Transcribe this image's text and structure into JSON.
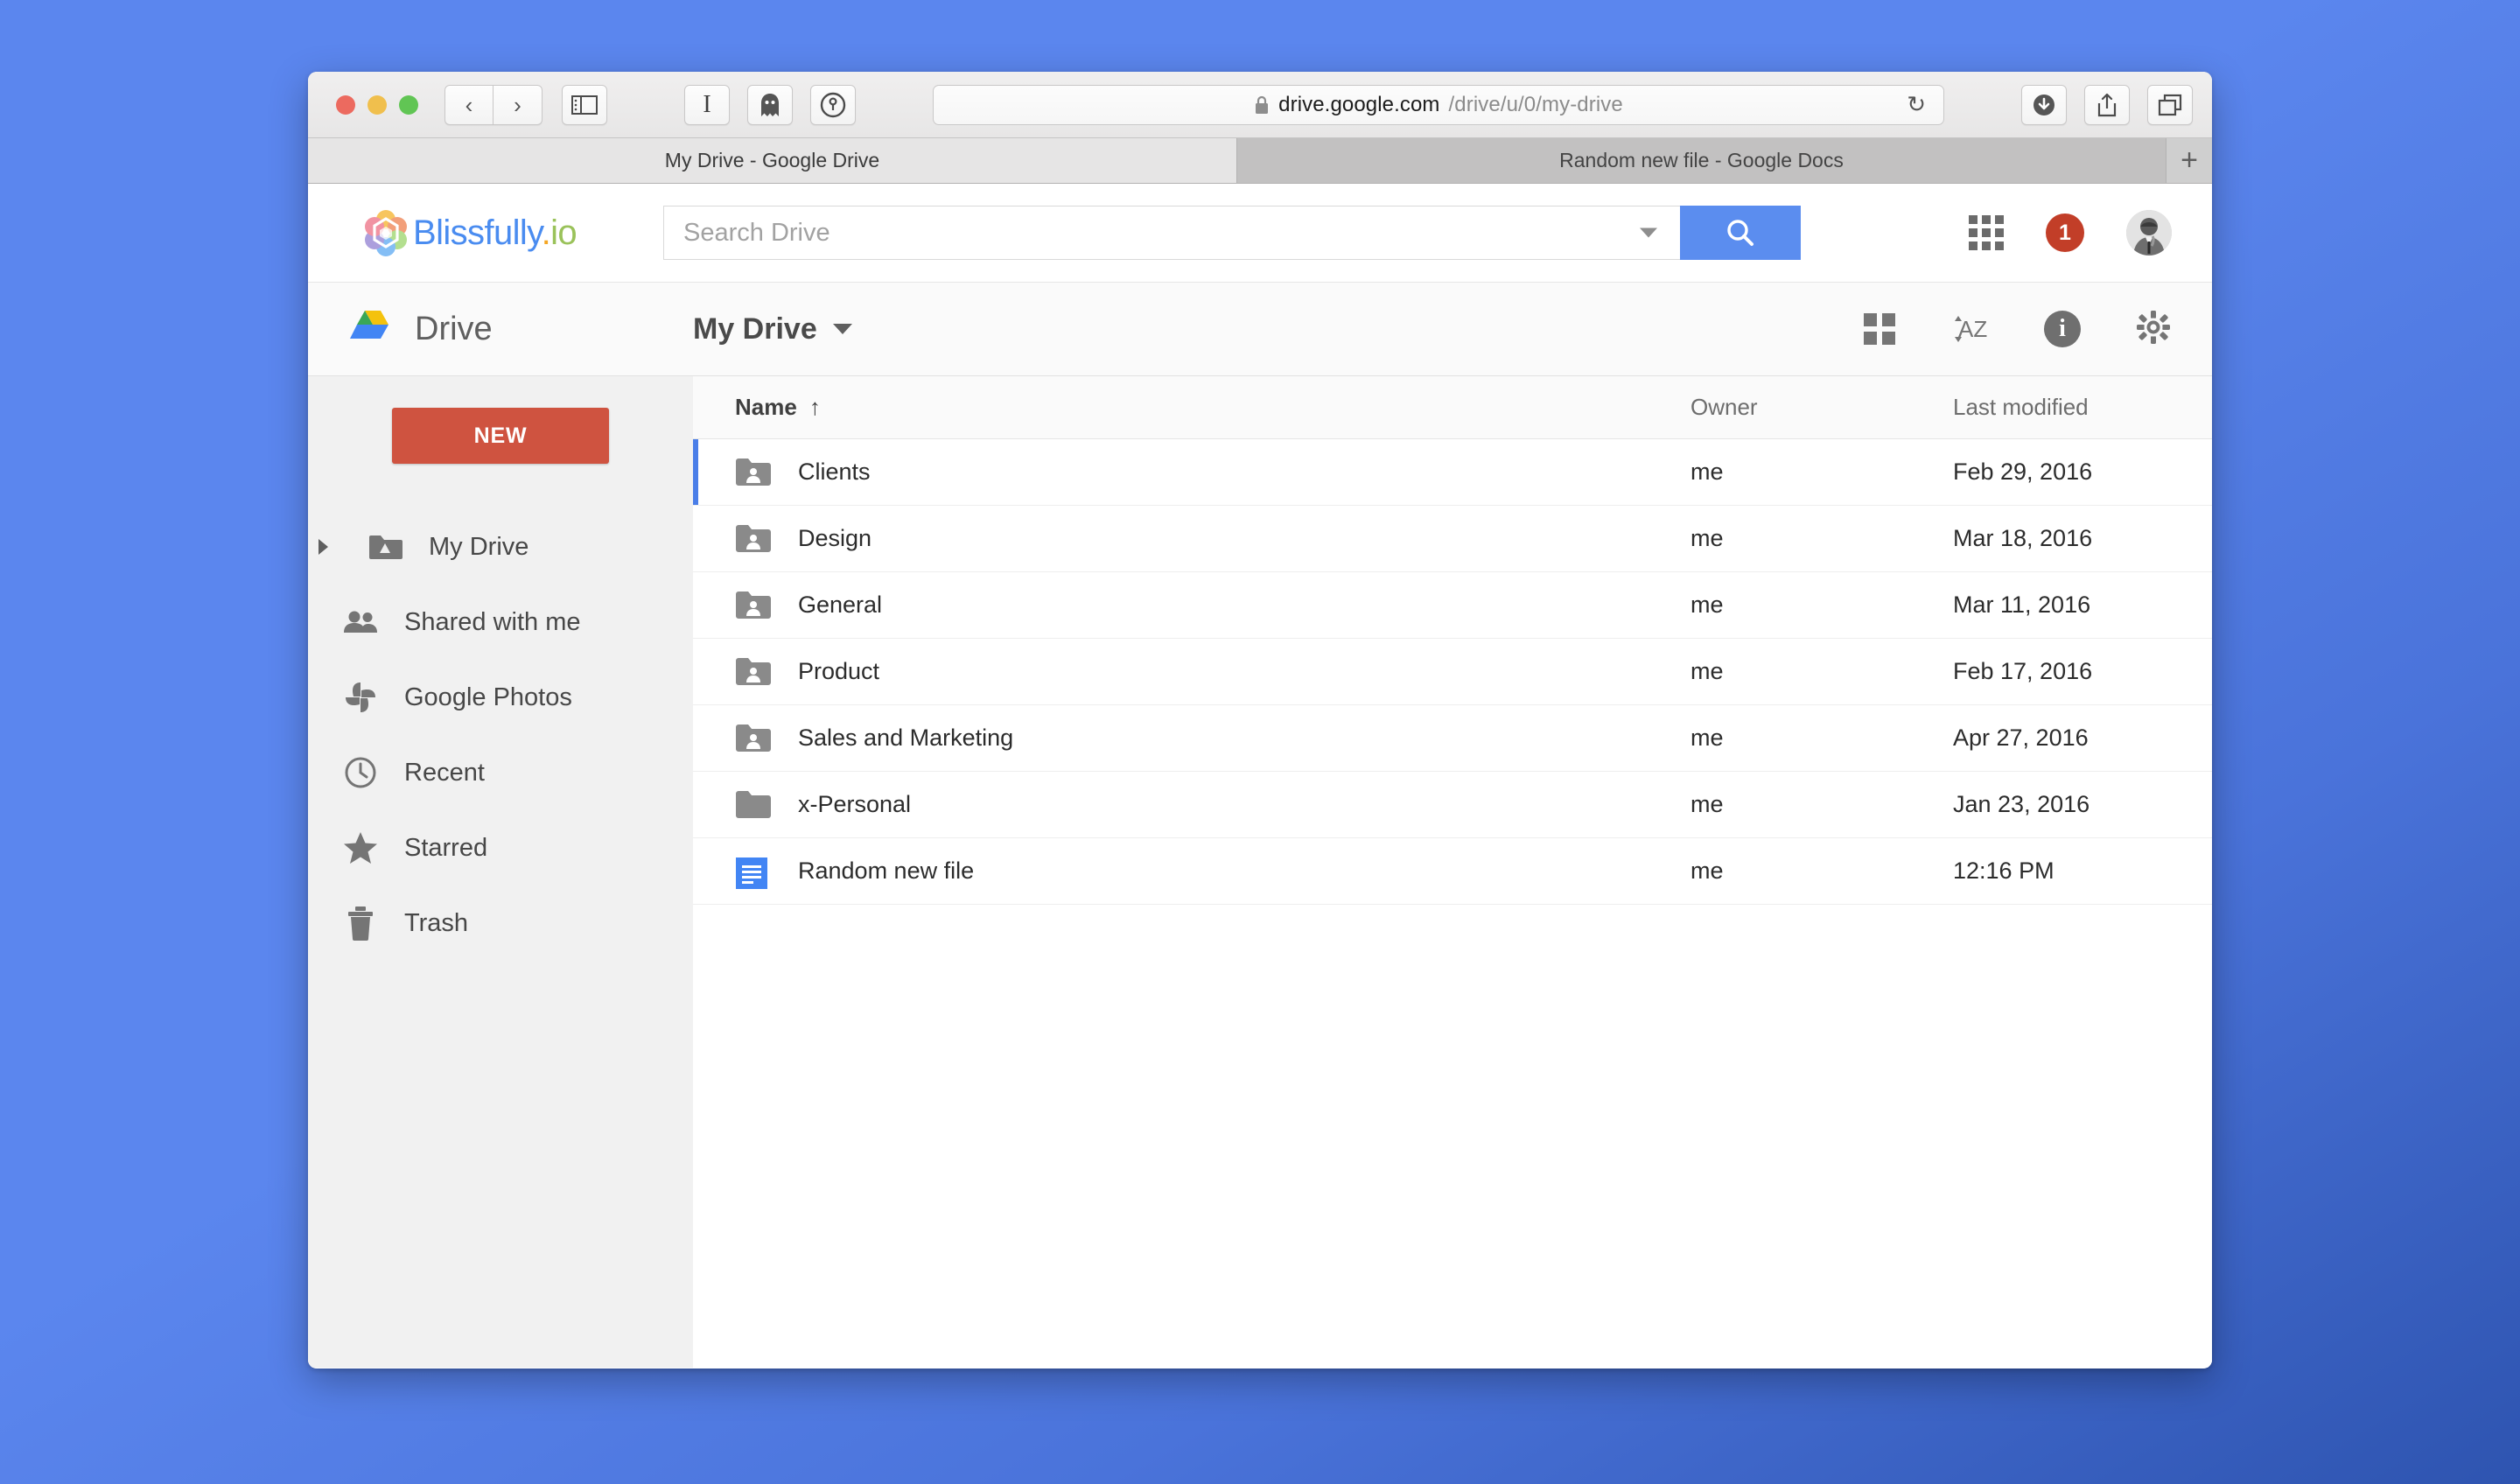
{
  "browser": {
    "traffic_lights": [
      "close",
      "minimize",
      "maximize"
    ],
    "back_label": "‹",
    "forward_label": "›",
    "sidebar_toggle_icon": "sidebar-icon",
    "reader_icon": "reader-icon",
    "ghost_icon": "ghost-icon",
    "key_icon": "key-icon",
    "lock_icon": "lock-icon",
    "url_host": "drive.google.com",
    "url_path": "/drive/u/0/my-drive",
    "reload_icon": "↻",
    "download_icon": "download-icon",
    "share_icon": "share-icon",
    "tabs_icon": "tabs-overview-icon",
    "tabs": [
      {
        "title": "My Drive - Google Drive",
        "active": true
      },
      {
        "title": "Random new file - Google Docs",
        "active": false
      }
    ],
    "new_tab_label": "+"
  },
  "blissbar": {
    "logo_name": "Blissfully",
    "logo_dot": ".",
    "logo_tld": "io",
    "search_placeholder": "Search Drive",
    "search_value": "",
    "search_button_icon": "search-icon",
    "apps_icon": "apps-grid-icon",
    "notification_count": "1",
    "avatar_icon": "user-avatar"
  },
  "driveheader": {
    "product_name": "Drive",
    "drive_logo_icon": "google-drive-logo",
    "breadcrumb": "My Drive",
    "breadcrumb_caret": "chevron-down-icon",
    "grid_view_icon": "grid-view-icon",
    "sort_label": "AZ",
    "sort_icon": "sort-az-icon",
    "info_letter": "i",
    "info_icon": "info-icon",
    "settings_icon": "gear-icon"
  },
  "sidebar": {
    "new_button": "NEW",
    "items": [
      {
        "label": "My Drive",
        "icon": "drive-folder-icon",
        "expandable": true
      },
      {
        "label": "Shared with me",
        "icon": "people-icon",
        "expandable": false
      },
      {
        "label": "Google Photos",
        "icon": "google-photos-icon",
        "expandable": false
      },
      {
        "label": "Recent",
        "icon": "clock-icon",
        "expandable": false
      },
      {
        "label": "Starred",
        "icon": "star-icon",
        "expandable": false
      },
      {
        "label": "Trash",
        "icon": "trash-icon",
        "expandable": false
      }
    ]
  },
  "filelist": {
    "columns": {
      "name": "Name",
      "name_sort_arrow": "↑",
      "owner": "Owner",
      "modified": "Last modified"
    },
    "rows": [
      {
        "name": "Clients",
        "owner": "me",
        "modified": "Feb 29, 2016",
        "icon": "shared-folder-icon",
        "selected": true
      },
      {
        "name": "Design",
        "owner": "me",
        "modified": "Mar 18, 2016",
        "icon": "shared-folder-icon",
        "selected": false
      },
      {
        "name": "General",
        "owner": "me",
        "modified": "Mar 11, 2016",
        "icon": "shared-folder-icon",
        "selected": false
      },
      {
        "name": "Product",
        "owner": "me",
        "modified": "Feb 17, 2016",
        "icon": "shared-folder-icon",
        "selected": false
      },
      {
        "name": "Sales and Marketing",
        "owner": "me",
        "modified": "Apr 27, 2016",
        "icon": "shared-folder-icon",
        "selected": false
      },
      {
        "name": "x-Personal",
        "owner": "me",
        "modified": "Jan 23, 2016",
        "icon": "folder-icon",
        "selected": false
      },
      {
        "name": "Random new file",
        "owner": "me",
        "modified": "12:16 PM",
        "icon": "google-docs-icon",
        "selected": false
      }
    ]
  },
  "colors": {
    "desktop_background": "#5b86ee",
    "accent_blue": "#5b8def",
    "new_button_red": "#cf5340",
    "badge_red": "#c23e28",
    "selection_blue": "#4a7ee8",
    "docs_blue": "#4285f4"
  }
}
